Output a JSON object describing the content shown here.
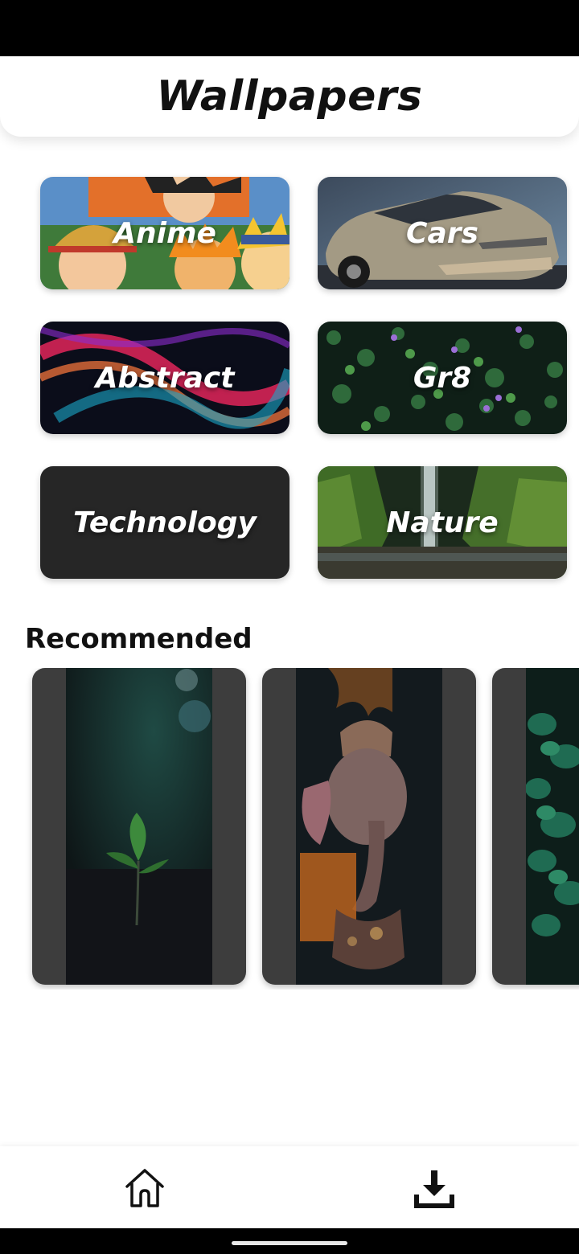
{
  "app": {
    "title": "Wallpapers"
  },
  "categories": [
    {
      "id": "anime",
      "label": "Anime"
    },
    {
      "id": "cars",
      "label": "Cars"
    },
    {
      "id": "abstract",
      "label": "Abstract"
    },
    {
      "id": "gr8",
      "label": "Gr8"
    },
    {
      "id": "technology",
      "label": "Technology"
    },
    {
      "id": "nature",
      "label": "Nature"
    }
  ],
  "recommended": {
    "title": "Recommended",
    "items": [
      {
        "subject": "seedling"
      },
      {
        "subject": "ganesha-statue"
      },
      {
        "subject": "green-leaves"
      }
    ]
  },
  "bottom_nav": {
    "items": [
      {
        "icon": "home-icon"
      },
      {
        "icon": "download-icon"
      }
    ]
  },
  "colors": {
    "background": "#ffffff",
    "text": "#111111",
    "card_placeholder": "#3d3d3d",
    "technology_card": "#262626"
  }
}
